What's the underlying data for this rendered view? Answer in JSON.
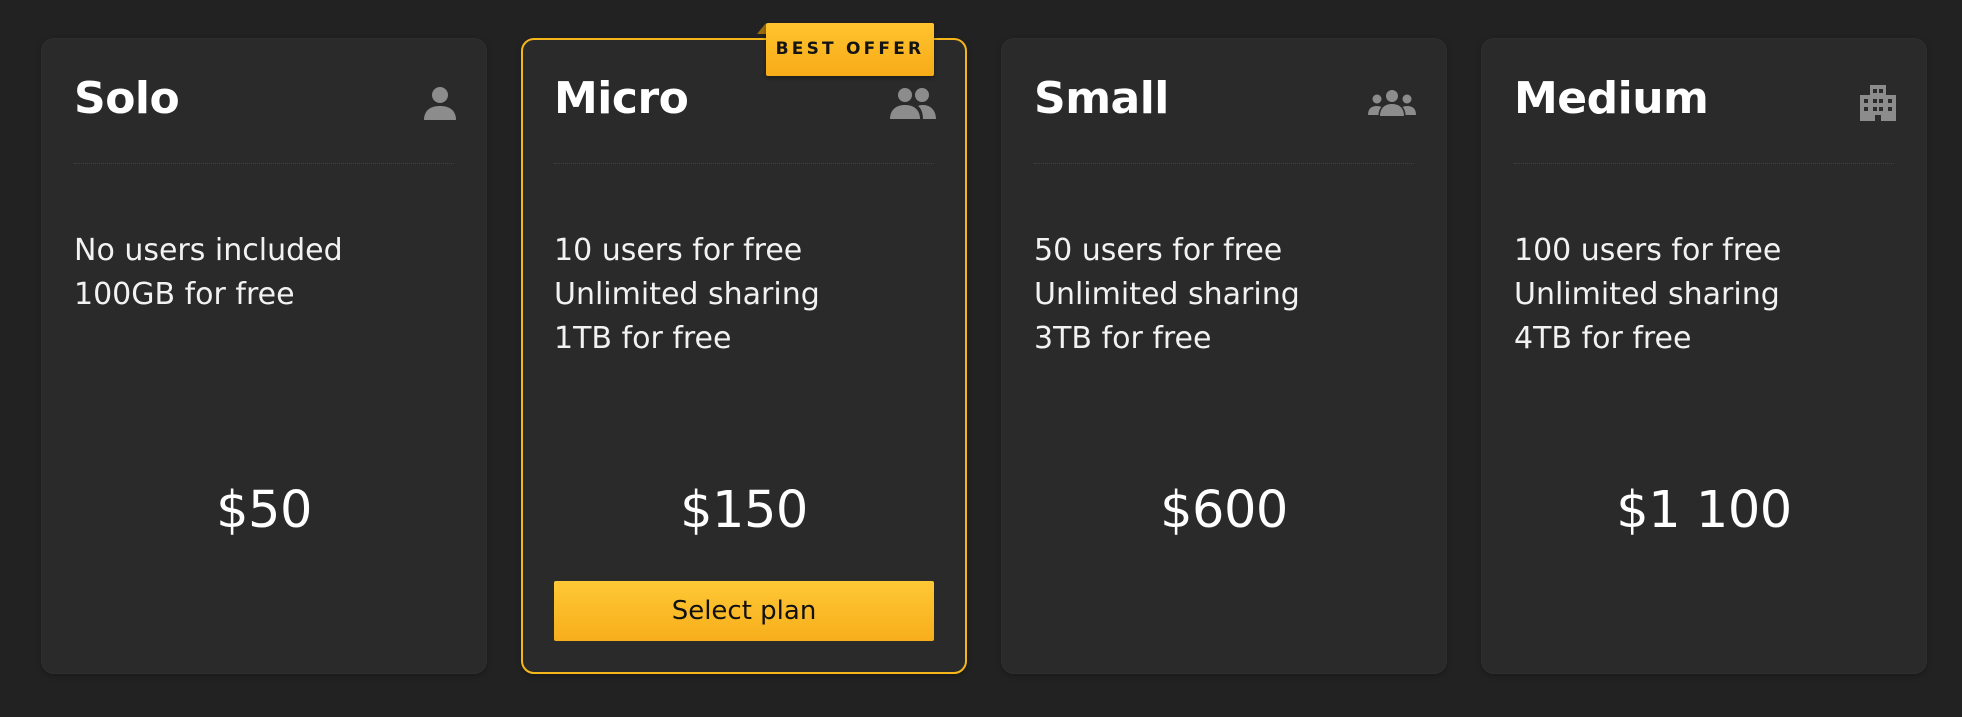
{
  "badge": {
    "label": "BEST OFFER"
  },
  "plans": [
    {
      "name": "Solo",
      "icon": "person-icon",
      "features": [
        "No users included",
        "100GB for free"
      ],
      "price": "$50"
    },
    {
      "name": "Micro",
      "icon": "people-icon",
      "features": [
        "10 users for free",
        "Unlimited sharing",
        "1TB for free"
      ],
      "price": "$150",
      "button_label": "Select plan",
      "highlighted": true
    },
    {
      "name": "Small",
      "icon": "group-icon",
      "features": [
        "50 users for free",
        "Unlimited sharing",
        "3TB for free"
      ],
      "price": "$600"
    },
    {
      "name": "Medium",
      "icon": "building-icon",
      "features": [
        "100 users for free",
        "Unlimited sharing",
        "4TB for free"
      ],
      "price": "$1 100"
    }
  ],
  "colors": {
    "page_background": "#222222",
    "card_background": "#2a2a2a",
    "accent": "#f7b21c",
    "icon": "#8c8c8c",
    "text": "#ffffff"
  }
}
